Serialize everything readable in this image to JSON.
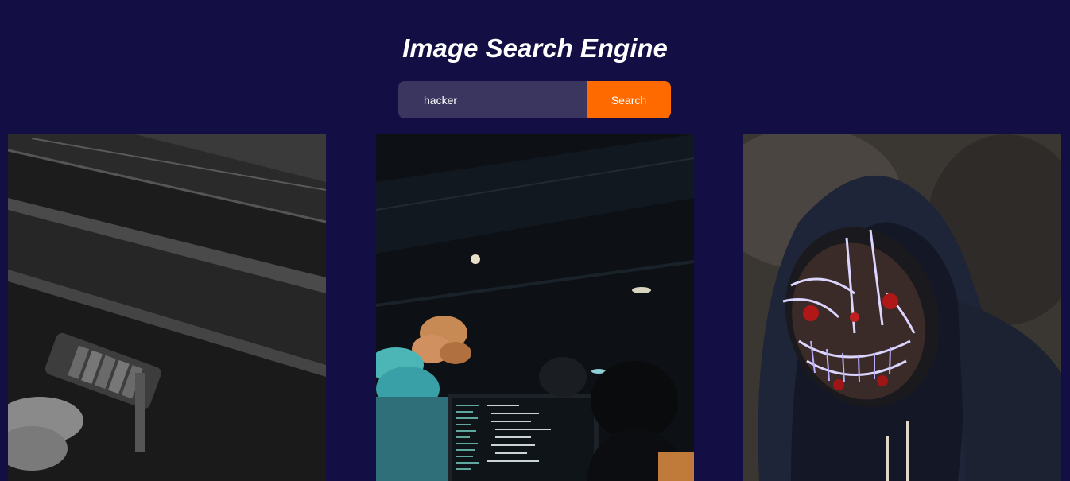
{
  "header": {
    "title": "Image Search Engine"
  },
  "search": {
    "value": "hacker",
    "button_label": "Search"
  },
  "colors": {
    "background": "#130f45",
    "input_bg": "#3a365f",
    "accent": "#ff6a00"
  },
  "results": [
    {
      "subject": "black-and-white combination padlock on wooden planks"
    },
    {
      "subject": "person coding at a computer monitor in a dark office"
    },
    {
      "subject": "hooded person wearing a glowing LED mask"
    }
  ]
}
